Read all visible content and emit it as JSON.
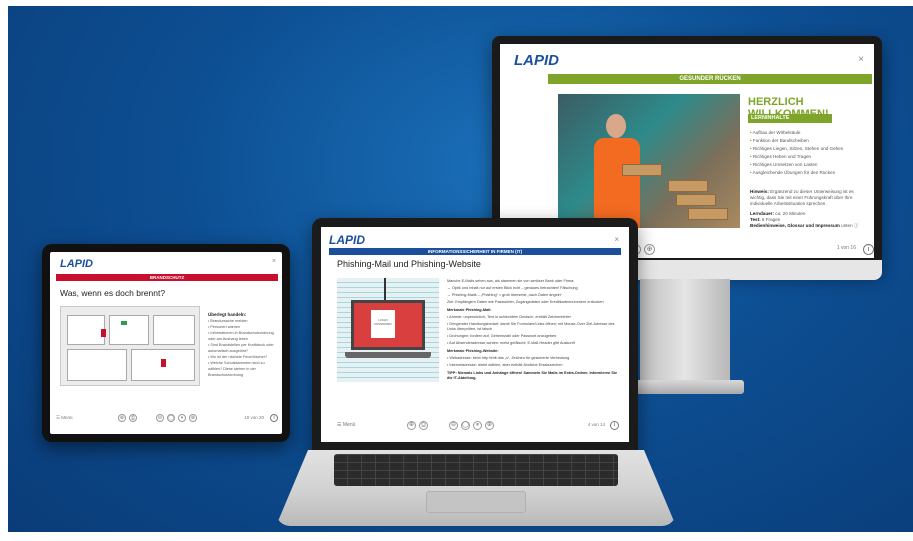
{
  "desktop": {
    "logo": "LAPID",
    "close": "×",
    "module_bar": "GESUNDER RÜCKEN",
    "heading": "HERZLICH WILLKOMMEN!",
    "section_bar": "LERNINHALTE",
    "contents": [
      "Aufbau der Wirbelsäule",
      "Funktion der Bandscheiben",
      "Richtiges Liegen, Sitzen, Stehen und Gehen",
      "Richtiges Heben und Tragen",
      "Richtiges Umsetzen von Lasten",
      "Ausgleichende Übungen für den Rücken"
    ],
    "hint_label": "Hinweis:",
    "hint_text": "Ergänzend zu dieser Unterweisung ist es wichtig, dass Sie mit einer Führungskraft über Ihre individuelle Arbeitssituation sprechen.",
    "duration_label": "Lerndauer:",
    "duration_value": "ca. 20 Minuten",
    "test_label": "Test:",
    "test_value": "6 Fragen",
    "usage_label": "Bedienhinweise, Glossar und Impressum",
    "usage_value": "unten ⓘ",
    "page_indicator": "1 von 16",
    "info": "i"
  },
  "tablet": {
    "logo": "LAPID",
    "close": "×",
    "module_bar": "BRANDSCHUTZ",
    "title": "Was, wenn es doch brennt?",
    "side_title": "Überlegt handeln:",
    "side_items": [
      "Brandursache melden",
      "Personen warnen",
      "Informationen in Brandschutzordnung oder am Aushang lesen",
      "Sind Brandstellen per Kraftdruck oder automatisch ausgelöst?",
      "Wo ist der nächste Feuerlöscher?",
      "Welche Schutzkammern sind zu wählen? Diese stehen in der Brandschutzordnung"
    ],
    "menu": "☰ Menü",
    "page_indicator": "10 von 20",
    "info": "i"
  },
  "laptop": {
    "logo": "LAPID",
    "close": "×",
    "module_bar": "INFORMATIONSSICHERHEIT IN FIRMEN (IT)",
    "title": "Phishing-Mail und Phishing-Website",
    "paper_label": "LOGIN PASSWORD",
    "paragraphs": [
      {
        "cls": "",
        "text": "Manche E-Mails sehen aus, als stammen sie von seriöser Bank oder Firma:"
      },
      {
        "cls": "",
        "text": "→ Optik und Inhalt nur auf ersten Blick echt – genaues betrachten! Fälschung"
      },
      {
        "cls": "",
        "text": "→ Phishing-Mails – „Phishing“ = grob übersetzt „nach Daten angeln“"
      },
      {
        "cls": "",
        "text": "Ziel: Empfängern Daten wie Passwörter, Zugangsdaten oder Kreditkartennummern entlocken"
      },
      {
        "cls": "h",
        "text": "Merkmale Phishing-Mail:"
      },
      {
        "cls": "",
        "text": "• Anrede: unpersönlich, Text in schlechtem Deutsch, enthält Zeichenfehler"
      },
      {
        "cls": "",
        "text": "• Dringender Handlungsbedarf: damit Sie Formulare/Links öffnen; mit Mouse-Over Ziel-Adresse des Links überprüfen, ist falsch"
      },
      {
        "cls": "",
        "text": "• Drohungen: fordern auf, Geheimzahl oder Passwort anzugeben"
      },
      {
        "cls": "",
        "text": "• Auf Absenderadresse achten: meist gefälscht; E-Mail-Header gibt Auskunft"
      },
      {
        "cls": "h",
        "text": "Merkmale Phishing-Website:"
      },
      {
        "cls": "",
        "text": "• Webadresse: beim http fehlt das „s“, Zeichen für gesicherte Verbindung"
      },
      {
        "cls": "",
        "text": "• Internetadresse: direkt wählen, aber enthält ähnliche Ersatzzeichen"
      },
      {
        "cls": "h",
        "text": "TIPP: Niemals Links und Anhänge öffnen! Sammeln Sie Mails im Extra-Ordner. Informieren Sie die IT-Abteilung."
      }
    ],
    "menu": "☰ Menü",
    "page_indicator": "4 von 14",
    "info": "i"
  },
  "controls": [
    "⊕",
    "⎙",
    "⊖",
    "◯",
    "⏸",
    "⊕"
  ],
  "colors": {
    "background": "#0d4f93",
    "brand_blue": "#1b4f9c",
    "green": "#7ea52a",
    "red": "#c8102e",
    "orange_vest": "#f36b21"
  }
}
